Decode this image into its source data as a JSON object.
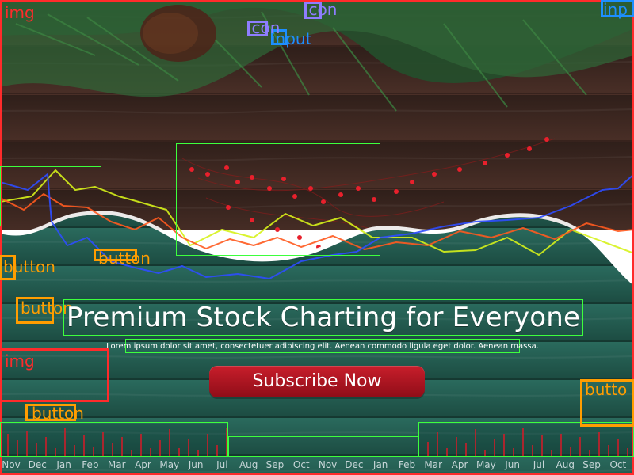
{
  "hero": {
    "headline": "Premium Stock Charting for Everyone",
    "subtext": "Lorem ipsum dolor sit amet, consectetuer adipiscing elit. Aenean commodo ligula eget dolor. Aenean massa.",
    "cta_label": "Subscribe Now"
  },
  "axis": {
    "months": [
      "Nov",
      "Dec",
      "Jan",
      "Feb",
      "Mar",
      "Apr",
      "May",
      "Jun",
      "Jul",
      "Aug",
      "Sep",
      "Oct",
      "Nov",
      "Dec",
      "Jan",
      "Feb",
      "Mar",
      "Apr",
      "May",
      "Jun",
      "Jul",
      "Aug",
      "Sep",
      "Oct"
    ]
  },
  "annotations": {
    "img1": "img",
    "img2": "img",
    "icon1": "icon",
    "icon2": "icon",
    "input1": "input",
    "input2": "inp",
    "button1": "button",
    "button2": "button",
    "button3": "button",
    "button4": "button",
    "button5": "butto"
  },
  "colors": {
    "page_bg": "#ffffff",
    "wood_dark": "#3a2620",
    "green_wall": "#245b4f",
    "cta_red": "#b7141f",
    "annot_red": "#ff2b2b",
    "annot_orange": "#ff9d00",
    "annot_blue": "#1d8fff",
    "annot_purple": "#8e7dff",
    "annot_green": "#3dff3d"
  },
  "icons": {
    "pine_icon": "pine-branch",
    "berry_icon": "red-berry-sprig"
  }
}
